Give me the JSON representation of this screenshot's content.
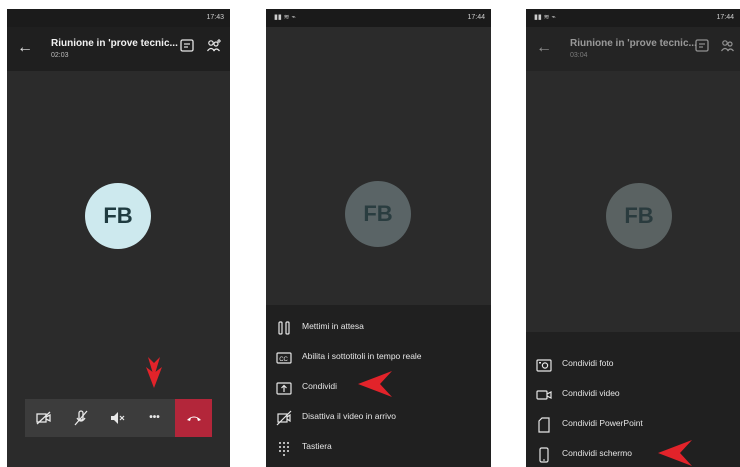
{
  "colors": {
    "accent_red": "#e2232a",
    "hangup": "#b3263a",
    "avatar_bg": "#cde9ee"
  },
  "screen1": {
    "status_time": "17:43",
    "meeting_title": "Riunione in 'prove tecnic...",
    "duration": "02:03",
    "avatar_initials": "FB",
    "controls": [
      "video-off-icon",
      "mic-off-icon",
      "speaker-mute-icon",
      "more-icon",
      "hang-up-icon"
    ],
    "more_label": "•••"
  },
  "screen2": {
    "status_time": "17:44",
    "avatar_initials": "FB",
    "menu": [
      {
        "icon": "hold-icon",
        "label": "Mettimi in attesa"
      },
      {
        "icon": "captions-icon",
        "label": "Abilita i sottotitoli in tempo reale"
      },
      {
        "icon": "share-icon",
        "label": "Condividi"
      },
      {
        "icon": "incoming-video-off-icon",
        "label": "Disattiva il video in arrivo"
      },
      {
        "icon": "keypad-icon",
        "label": "Tastiera"
      }
    ]
  },
  "screen3": {
    "status_time": "17:44",
    "meeting_title": "Riunione in 'prove tecnic...",
    "duration": "03:04",
    "avatar_initials": "FB",
    "menu": [
      {
        "icon": "photo-icon",
        "label": "Condividi foto"
      },
      {
        "icon": "video-icon",
        "label": "Condividi video"
      },
      {
        "icon": "powerpoint-icon",
        "label": "Condividi PowerPoint"
      },
      {
        "icon": "phone-screen-icon",
        "label": "Condividi schermo"
      }
    ]
  }
}
